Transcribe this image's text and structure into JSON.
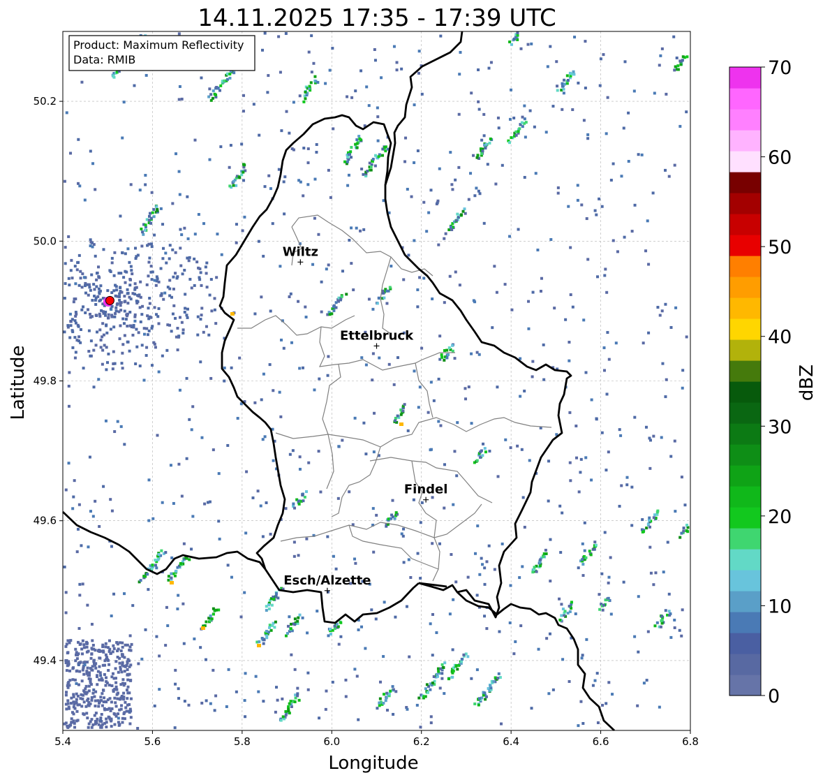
{
  "title": "14.11.2025 17:35 - 17:39 UTC",
  "info_box": {
    "line1": "Product: Maximum Reflectivity",
    "line2": "Data: RMIB"
  },
  "map": {
    "xlabel": "Longitude",
    "ylabel": "Latitude",
    "xlim": [
      5.4,
      6.8
    ],
    "ylim": [
      49.3,
      50.3
    ],
    "xticks": [
      5.4,
      5.6,
      5.8,
      6.0,
      6.2,
      6.4,
      6.6,
      6.8
    ],
    "xtick_labels": [
      "5.4",
      "5.6",
      "5.8",
      "6.0",
      "6.2",
      "6.4",
      "6.6",
      "6.8"
    ],
    "yticks": [
      49.4,
      49.6,
      49.8,
      50.0,
      50.2
    ],
    "ytick_labels": [
      "49.4",
      "49.6",
      "49.8",
      "50.0",
      "50.2"
    ],
    "grid": true
  },
  "cities": [
    {
      "name": "Wiltz",
      "lon": 5.93,
      "lat": 49.97
    },
    {
      "name": "Ettelbruck",
      "lon": 6.1,
      "lat": 49.85
    },
    {
      "name": "Findel",
      "lon": 6.21,
      "lat": 49.63
    },
    {
      "name": "Esch/Alzette",
      "lon": 5.99,
      "lat": 49.5
    }
  ],
  "radar_site": {
    "lon": 5.505,
    "lat": 49.915,
    "color": "#ff0000"
  },
  "colorbar": {
    "label": "dBZ",
    "min": 0,
    "max": 70,
    "ticks": [
      "0",
      "10",
      "20",
      "30",
      "40",
      "50",
      "60",
      "70"
    ],
    "colors": [
      "#6674a8",
      "#5869a2",
      "#4a5fa2",
      "#4a7ab5",
      "#5a9fc8",
      "#68c4dc",
      "#62d9c6",
      "#3fd670",
      "#12c81e",
      "#10b81a",
      "#0fa316",
      "#0e8e16",
      "#0c7a14",
      "#0a6712",
      "#075a0c",
      "#457a0c",
      "#b2b20b",
      "#ffd600",
      "#ffb800",
      "#ff9d00",
      "#ff7f00",
      "#e80000",
      "#c80000",
      "#a30000",
      "#780000",
      "#ffe0ff",
      "#ffb3ff",
      "#ff80ff",
      "#ff66ff",
      "#ee33ee"
    ]
  }
}
